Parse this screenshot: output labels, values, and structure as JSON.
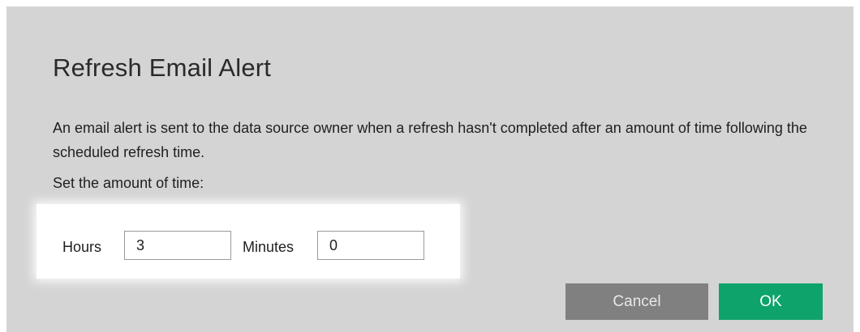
{
  "dialog": {
    "title": "Refresh Email Alert",
    "description": "An email alert is sent to the data source owner when a refresh hasn't completed after an amount of time following the scheduled refresh time.",
    "set_time_label": "Set the amount of time:",
    "hours": {
      "label": "Hours",
      "value": "3"
    },
    "minutes": {
      "label": "Minutes",
      "value": "0"
    },
    "buttons": {
      "cancel": "Cancel",
      "ok": "OK"
    }
  },
  "colors": {
    "dialog_background": "#d4d4d4",
    "ok_button": "#0ea36a",
    "cancel_button": "#808080"
  }
}
